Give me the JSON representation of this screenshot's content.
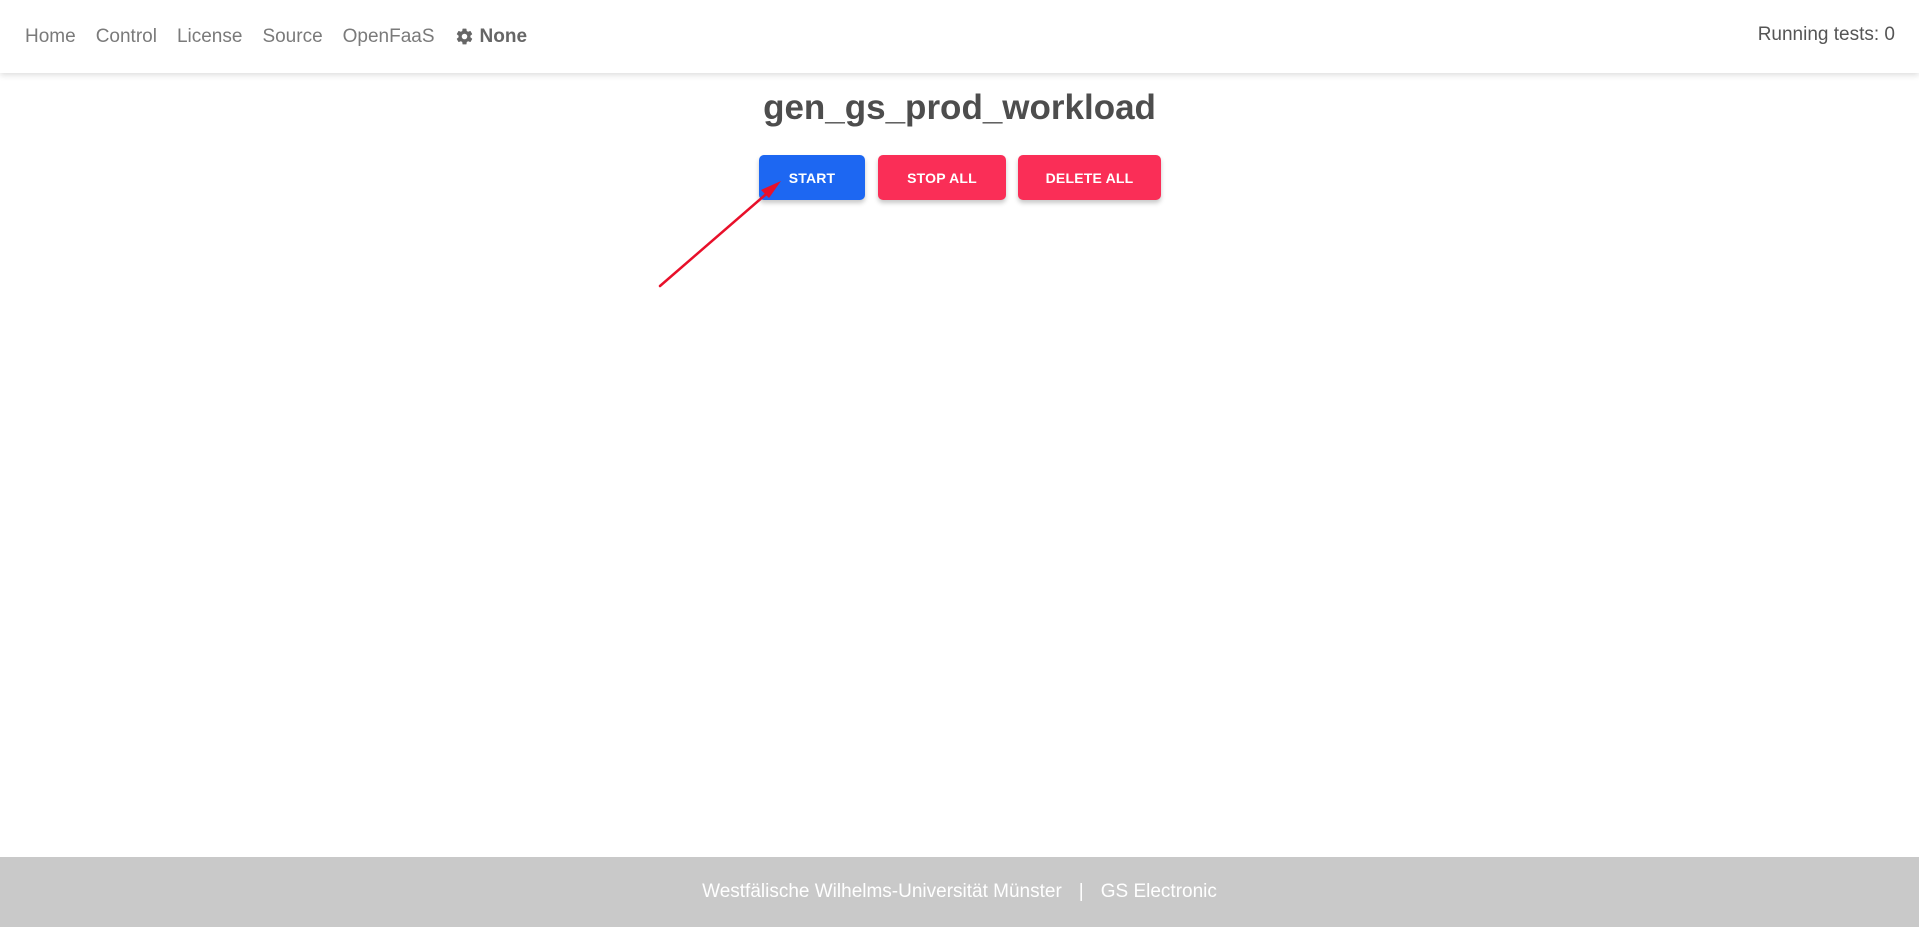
{
  "nav": {
    "links": [
      "Home",
      "Control",
      "License",
      "Source",
      "OpenFaaS"
    ],
    "settings": {
      "icon": "gear-icon",
      "label": "None"
    },
    "running_tests": "Running tests: 0"
  },
  "main": {
    "title": "gen_gs_prod_workload",
    "buttons": {
      "start": "START",
      "stop_all": "STOP ALL",
      "delete_all": "DELETE ALL"
    }
  },
  "footer": {
    "left": "Westfälische Wilhelms-Universität Münster",
    "separator": "|",
    "right": "GS Electronic"
  },
  "colors": {
    "primary": "#1d67f2",
    "danger": "#fa2e57",
    "footer_bg": "#c9c9c9",
    "annotation_arrow": "#e8102a"
  }
}
